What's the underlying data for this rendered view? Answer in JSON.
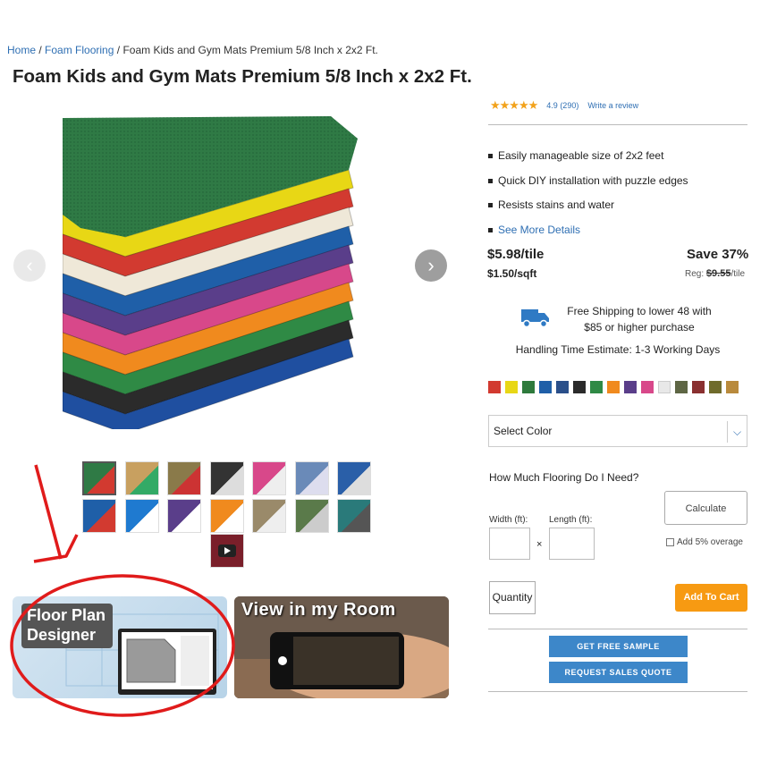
{
  "breadcrumb": {
    "home": "Home",
    "category": "Foam Flooring",
    "sep": "/",
    "current": "Foam Kids and Gym Mats Premium 5/8 Inch x 2x2 Ft."
  },
  "product": {
    "title": "Foam Kids and Gym Mats Premium 5/8 Inch x 2x2 Ft."
  },
  "rating": {
    "stars": "★★★★★",
    "score": "4.9",
    "count": "(290)",
    "write_review": "Write a review"
  },
  "features": [
    "Easily manageable size of 2x2 feet",
    "Quick DIY installation with puzzle edges",
    "Resists stains and water"
  ],
  "see_more": "See More Details",
  "pricing": {
    "price": "$5.98/tile",
    "per_sqft": "$1.50/sqft",
    "save": "Save 37%",
    "reg_label": "Reg:",
    "reg_price": "$9.55",
    "reg_unit": "/tile"
  },
  "shipping": {
    "line1": "Free Shipping to lower 48 with",
    "line2": "$85 or higher purchase",
    "handling": "Handling Time Estimate: 1-3 Working Days"
  },
  "swatches": [
    "#d23a30",
    "#e8d715",
    "#2e7a3c",
    "#1f5fa8",
    "#2a4f8a",
    "#2b2b2b",
    "#2f8a45",
    "#f08a1e",
    "#5a3e8a",
    "#d8488a",
    "#e8e8e8",
    "#5e6644",
    "#8a3030",
    "#6f6b2c",
    "#b98a3c"
  ],
  "select_color": {
    "label": "Select Color",
    "chevron": "⌵"
  },
  "calculator": {
    "title": "How Much Flooring Do I Need?",
    "calculate": "Calculate",
    "width_label": "Width (ft):",
    "length_label": "Length (ft):",
    "times": "×",
    "overage": "Add 5% overage"
  },
  "cart": {
    "quantity": "Quantity",
    "add": "Add To Cart"
  },
  "actions": {
    "sample": "GET FREE SAMPLE",
    "quote": "REQUEST SALES QUOTE"
  },
  "banners": {
    "floor_plan_line1": "Floor Plan",
    "floor_plan_line2": "Designer",
    "view_room": "View in my Room"
  },
  "carousel": {
    "prev": "‹",
    "next": "›"
  },
  "colors": {
    "link": "#2f6fb3",
    "accent_orange": "#f79a12",
    "button_blue": "#3d87c9",
    "annotation_red": "#e01b1b"
  }
}
